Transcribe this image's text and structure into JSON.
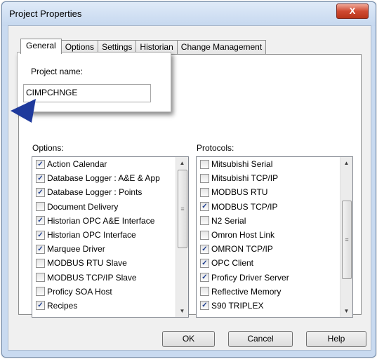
{
  "window": {
    "title": "Project Properties",
    "close_glyph": "X"
  },
  "tabs": [
    "General",
    "Options",
    "Settings",
    "Historian",
    "Change Management"
  ],
  "popup": {
    "label": "Project name:",
    "value": "CIMPCHNGE"
  },
  "options": {
    "label": "Options:",
    "items": [
      {
        "label": "Action Calendar",
        "checked": true
      },
      {
        "label": "Database Logger : A&E & App",
        "checked": true
      },
      {
        "label": "Database Logger : Points",
        "checked": true
      },
      {
        "label": "Document Delivery",
        "checked": false
      },
      {
        "label": "Historian OPC A&E Interface",
        "checked": true
      },
      {
        "label": "Historian OPC Interface",
        "checked": true
      },
      {
        "label": "Marquee Driver",
        "checked": true
      },
      {
        "label": "MODBUS RTU Slave",
        "checked": false
      },
      {
        "label": "MODBUS TCP/IP Slave",
        "checked": false
      },
      {
        "label": "Proficy SOA Host",
        "checked": false
      },
      {
        "label": "Recipes",
        "checked": true
      }
    ],
    "scroll_fraction": 0.0
  },
  "protocols": {
    "label": "Protocols:",
    "items": [
      {
        "label": "Mitsubishi Serial",
        "checked": false
      },
      {
        "label": "Mitsubishi TCP/IP",
        "checked": false
      },
      {
        "label": "MODBUS RTU",
        "checked": false
      },
      {
        "label": "MODBUS TCP/IP",
        "checked": true
      },
      {
        "label": "N2 Serial",
        "checked": false
      },
      {
        "label": "Omron Host Link",
        "checked": false
      },
      {
        "label": "OMRON TCP/IP",
        "checked": true
      },
      {
        "label": "OPC Client",
        "checked": true
      },
      {
        "label": "Proficy Driver Server",
        "checked": true
      },
      {
        "label": "Reflective Memory",
        "checked": false
      },
      {
        "label": "S90 TRIPLEX",
        "checked": true
      }
    ],
    "scroll_fraction": 0.55
  },
  "buttons": {
    "ok": "OK",
    "cancel": "Cancel",
    "help": "Help"
  },
  "glyphs": {
    "check": "✓",
    "up": "▲",
    "down": "▼",
    "grip": "≡"
  },
  "colors": {
    "pointer": "#1f3a9c",
    "check": "#1f3f8f"
  }
}
